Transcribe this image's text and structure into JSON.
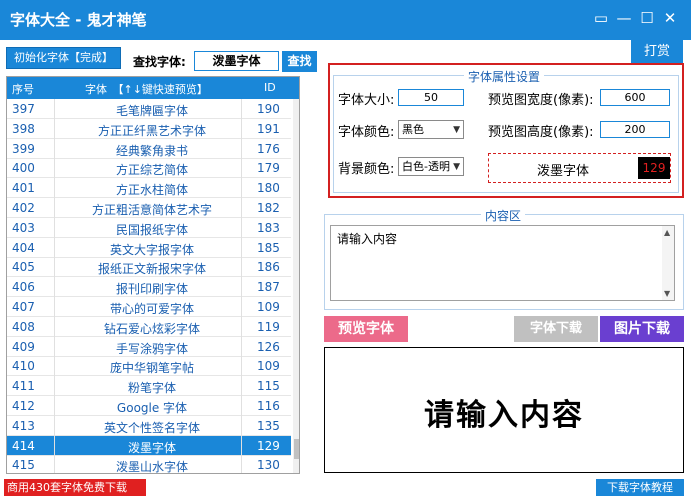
{
  "window": {
    "title": "字体大全 - 鬼才神笔"
  },
  "toolbar": {
    "init_label": "初始化字体【完成】",
    "find_label": "查找字体:",
    "find_value": "泼墨字体",
    "find_button": "查找",
    "tip_button": "打赏"
  },
  "table": {
    "headers": {
      "num": "序号",
      "name": "字体　【↑↓键快速预览】",
      "id": "ID"
    },
    "rows": [
      {
        "num": "397",
        "name": "毛笔牌匾字体",
        "id": "190"
      },
      {
        "num": "398",
        "name": "方正正纤黑艺术字体",
        "id": "191"
      },
      {
        "num": "399",
        "name": "经典繁角隶书",
        "id": "176"
      },
      {
        "num": "400",
        "name": "方正综艺简体",
        "id": "179"
      },
      {
        "num": "401",
        "name": "方正水柱简体",
        "id": "180"
      },
      {
        "num": "402",
        "name": "方正粗活意简体艺术字",
        "id": "182"
      },
      {
        "num": "403",
        "name": "民国报纸字体",
        "id": "183"
      },
      {
        "num": "404",
        "name": "英文大字报字体",
        "id": "185"
      },
      {
        "num": "405",
        "name": "报纸正文新报宋字体",
        "id": "186"
      },
      {
        "num": "406",
        "name": "报刊印刷字体",
        "id": "187"
      },
      {
        "num": "407",
        "name": "带心的可爱字体",
        "id": "109"
      },
      {
        "num": "408",
        "name": "钻石爱心炫彩字体",
        "id": "119"
      },
      {
        "num": "409",
        "name": "手写涂鸦字体",
        "id": "126"
      },
      {
        "num": "410",
        "name": "庞中华钢笔字帖",
        "id": "109"
      },
      {
        "num": "411",
        "name": "粉笔字体",
        "id": "115"
      },
      {
        "num": "412",
        "name": "Google 字体",
        "id": "116"
      },
      {
        "num": "413",
        "name": "英文个性签名字体",
        "id": "135"
      },
      {
        "num": "414",
        "name": "泼墨字体",
        "id": "129"
      },
      {
        "num": "415",
        "name": "泼墨山水字体",
        "id": "130"
      }
    ]
  },
  "red_banner": "商用430套字体免费下载",
  "props": {
    "group_title": "字体属性设置",
    "size_label": "字体大小:",
    "size_value": "50",
    "width_label": "预览图宽度(像素):",
    "width_value": "600",
    "color_label": "字体颜色:",
    "color_value": "黑色",
    "height_label": "预览图高度(像素):",
    "height_value": "200",
    "bg_label": "背景颜色:",
    "bg_value": "白色-透明",
    "mini_text": "泼墨字体",
    "mini_num": "129"
  },
  "content_group": {
    "title": "内容区",
    "text": "请输入内容"
  },
  "buttons": {
    "preview": "预览字体",
    "download_font": "字体下载",
    "download_image": "图片下载"
  },
  "preview": {
    "text": "请输入内容"
  },
  "bottom_link": "下载字体教程"
}
